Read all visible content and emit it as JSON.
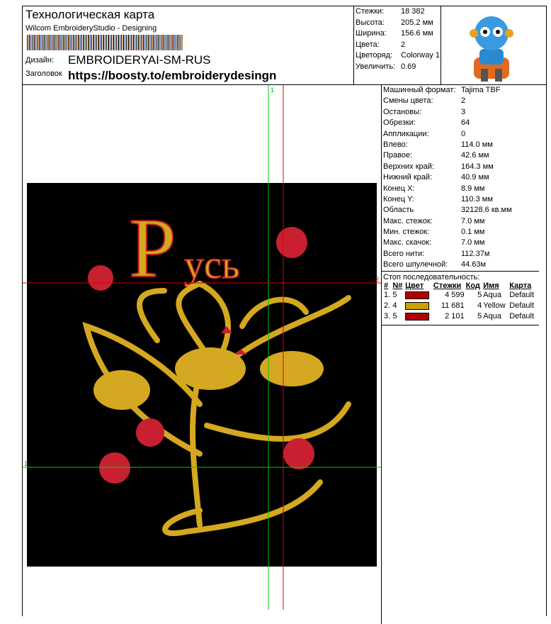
{
  "header": {
    "title": "Технологическая карта",
    "software": "Wilcom EmbroideryStudio - Designing",
    "design_label": "Дизайн:",
    "design_value": "EMBROIDERYAI-SM-RUS",
    "heading_label": "Заголовок",
    "heading_value": "https://boosty.to/embroiderydesingn"
  },
  "stats": [
    {
      "k": "Стежки:",
      "v": "18 382"
    },
    {
      "k": "Высота:",
      "v": "205.2 мм"
    },
    {
      "k": "Ширина:",
      "v": "156.6 мм"
    },
    {
      "k": "Цвета:",
      "v": "2"
    },
    {
      "k": "Цветоряд:",
      "v": "Colorway 1"
    },
    {
      "k": "Увеличить:",
      "v": "0.69"
    }
  ],
  "info": [
    {
      "k": "Машинный формат:",
      "v": "Tajima TBF"
    },
    {
      "k": "Смены цвета:",
      "v": "2"
    },
    {
      "k": "Остановы:",
      "v": "3"
    },
    {
      "k": "Обрезки:",
      "v": "64"
    },
    {
      "k": "Аппликации:",
      "v": "0"
    },
    {
      "k": "Влево:",
      "v": "114.0 мм"
    },
    {
      "k": "Правое:",
      "v": "42.6 мм"
    },
    {
      "k": "Верхних край:",
      "v": "164.3 мм"
    },
    {
      "k": "Нижний край:",
      "v": "40.9 мм"
    },
    {
      "k": "Конец X:",
      "v": "8.9 мм"
    },
    {
      "k": "Конец Y:",
      "v": "110.3 мм"
    },
    {
      "k": "Область",
      "v": "32128.6 кв.мм"
    },
    {
      "k": "Макс. стежок:",
      "v": "7.0 мм"
    },
    {
      "k": "Мин. стежок:",
      "v": "0.1 мм"
    },
    {
      "k": "Макс. скачок:",
      "v": "7.0 мм"
    },
    {
      "k": "Всего нити:",
      "v": "112.37м"
    },
    {
      "k": "Всего шпулечной:",
      "v": "44.63м"
    }
  ],
  "stop": {
    "title": "Стоп последовательность:",
    "headers": [
      "#",
      "N#",
      "Цвет",
      "Стежки",
      "Код",
      "Имя",
      "Карта"
    ],
    "rows": [
      {
        "n": "1.",
        "nn": "5",
        "color": "#b00000",
        "stitches": "4 599",
        "code": "5",
        "name": "Aqua",
        "chart": "Default"
      },
      {
        "n": "2.",
        "nn": "4",
        "color": "#c8a000",
        "stitches": "11 681",
        "code": "4",
        "name": "Yellow",
        "chart": "Default"
      },
      {
        "n": "3.",
        "nn": "5",
        "color": "#b00000",
        "stitches": "2 101",
        "code": "5",
        "name": "Aqua",
        "chart": "Default"
      }
    ]
  },
  "guides": {
    "v1": "1",
    "h1": "1",
    "h2": "2"
  }
}
